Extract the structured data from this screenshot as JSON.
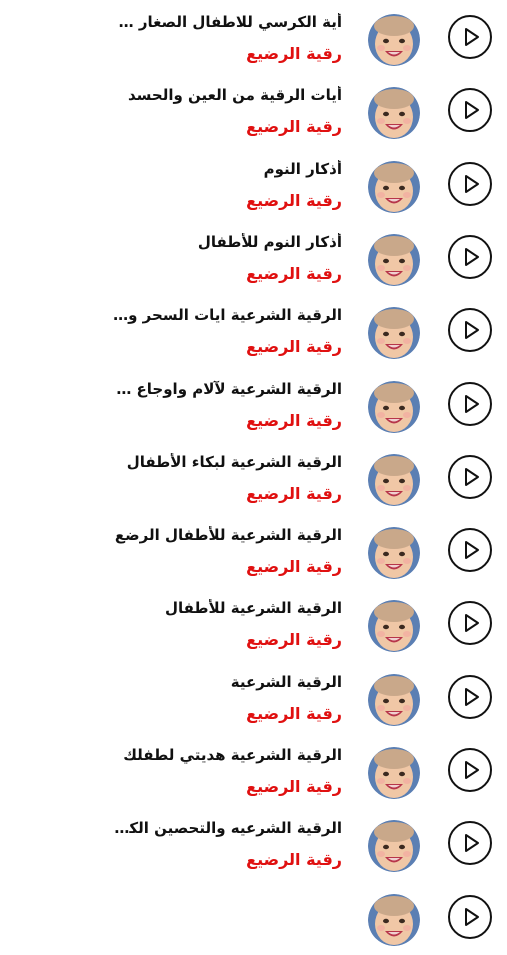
{
  "tracks": [
    {
      "title": "أية الكرسي للاطفال الصغار مكررة",
      "artist": "رقية الرضيع"
    },
    {
      "title": "أيات الرقية من العين والحسد",
      "artist": "رقية الرضيع"
    },
    {
      "title": "أذكار النوم",
      "artist": "رقية الرضيع"
    },
    {
      "title": "أذكار النوم للأطفال",
      "artist": "رقية الرضيع"
    },
    {
      "title": "الرقية الشرعية  ايات السحر والحسد",
      "artist": "رقية الرضيع"
    },
    {
      "title": "الرقية الشرعية لآلام واوجاع البطن",
      "artist": "رقية الرضيع"
    },
    {
      "title": "الرقية الشرعية لبكاء الأطفال",
      "artist": "رقية الرضيع"
    },
    {
      "title": "الرقية الشرعية للأطفال الرضع",
      "artist": "رقية الرضيع"
    },
    {
      "title": "الرقية الشرعية للأطفال",
      "artist": "رقية الرضيع"
    },
    {
      "title": "الرقية الشرعية",
      "artist": "رقية الرضيع"
    },
    {
      "title": "الرقية الشرعية هديتي لطفلك",
      "artist": "رقية الرضيع"
    },
    {
      "title": "الرقية الشرعيه والتحصين الكامل",
      "artist": "رقية الرضيع"
    },
    {
      "title": "",
      "artist": ""
    }
  ],
  "icons": {
    "play": "play-icon",
    "avatar": "baby-avatar"
  },
  "colors": {
    "title": "#111111",
    "artist": "#e01010",
    "background": "#ffffff"
  }
}
